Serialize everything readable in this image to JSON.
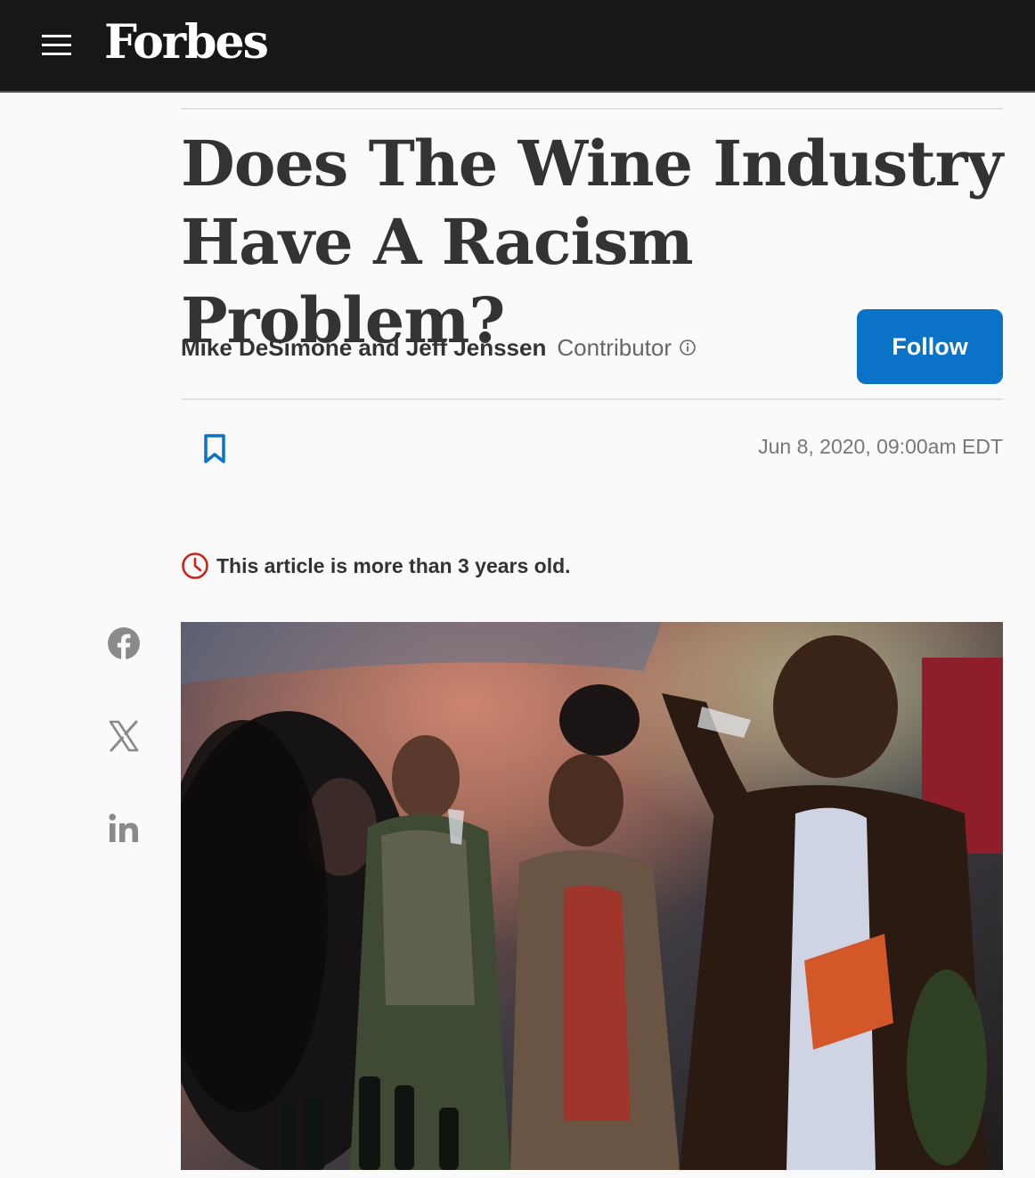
{
  "header": {
    "logo_text": "Forbes",
    "menu_icon": "hamburger-menu-icon",
    "background_color": "#181716"
  },
  "article": {
    "title": "Does The Wine Industry Have A Racism Problem?",
    "author": "Mike DeSimone and Jeff Jenssen",
    "author_role": "Contributor",
    "follow_label": "Follow",
    "date": "Jun 8, 2020, 09:00am EDT",
    "age_notice": "This article is more than 3 years old.",
    "accent_color": "#0a73c8",
    "notice_color": "#c8241c"
  },
  "share": {
    "icons": [
      "facebook-icon",
      "x-icon",
      "linkedin-icon"
    ]
  },
  "hero_image": {
    "description_icon": "wine-tasting-photo"
  }
}
